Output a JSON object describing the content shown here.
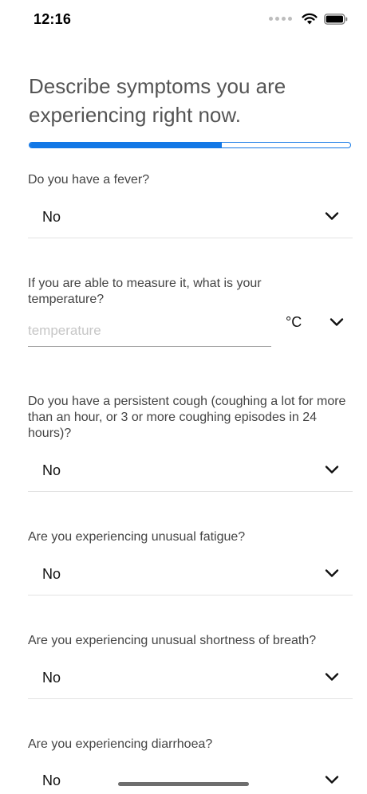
{
  "status_bar": {
    "time": "12:16"
  },
  "page_title": "Describe symptoms you are experiencing right now.",
  "progress": {
    "value": 0.6
  },
  "questions": [
    {
      "label": "Do you have a fever?",
      "value": "No"
    },
    {
      "label": "If you are able to measure it, what is your temperature?",
      "placeholder": "temperature",
      "unit": "°C"
    },
    {
      "label": "Do you have a persistent cough (coughing a lot for more than an hour, or 3 or more coughing episodes in 24 hours)?",
      "value": "No"
    },
    {
      "label": "Are you experiencing unusual fatigue?",
      "value": "No"
    },
    {
      "label": "Are you experiencing unusual shortness of breath?",
      "value": "No"
    },
    {
      "label": "Are you experiencing diarrhoea?",
      "value": "No"
    }
  ],
  "colors": {
    "accent": "#1378e6",
    "divider": "#e2e2e2"
  },
  "icons": {
    "chevron": "chevron-down-icon",
    "wifi": "wifi-icon",
    "battery": "battery-icon"
  }
}
